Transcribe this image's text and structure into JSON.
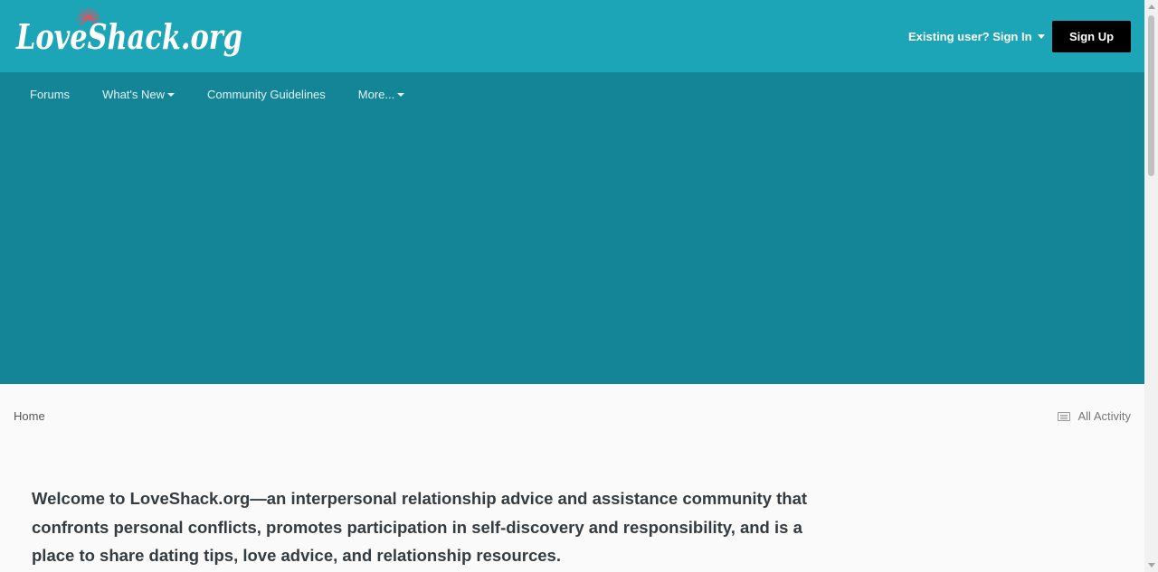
{
  "brand": {
    "logo_text": "LoveShack.org",
    "colors": {
      "header": "#1ba5b6",
      "nav_band": "#148596",
      "logo_accent": "#e6505e",
      "signup_bg": "#000000"
    }
  },
  "header": {
    "signin_label": "Existing user? Sign In",
    "signup_label": "Sign Up"
  },
  "nav": {
    "items": [
      {
        "label": "Forums",
        "icon": ""
      },
      {
        "label": "What's New",
        "icon": "caret-down-icon"
      },
      {
        "label": "Community Guidelines",
        "icon": ""
      },
      {
        "label": "More...",
        "icon": "caret-down-icon"
      }
    ]
  },
  "breadcrumb": {
    "home": "Home"
  },
  "activity": {
    "label": "All Activity",
    "icon": "newspaper-icon"
  },
  "main": {
    "welcome": "Welcome to LoveShack.org—an interpersonal relationship advice and assistance community that confronts personal conflicts, promotes participation in self-discovery and responsibility, and is a place to share dating tips, love advice, and relationship resources."
  }
}
